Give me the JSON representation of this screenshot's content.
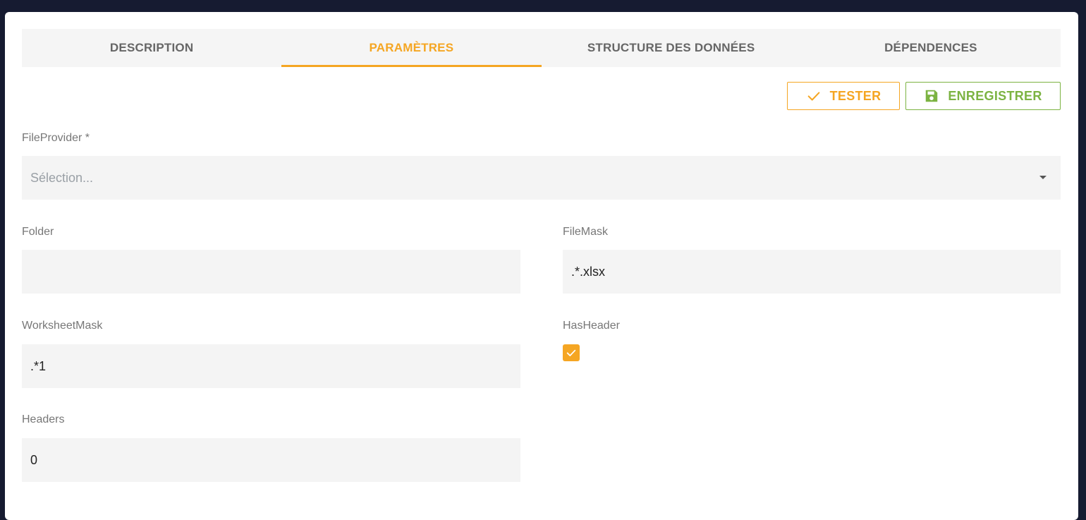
{
  "tabs": [
    {
      "label": "DESCRIPTION",
      "active": false
    },
    {
      "label": "PARAMÈTRES",
      "active": true
    },
    {
      "label": "STRUCTURE DES DONNÉES",
      "active": false
    },
    {
      "label": "DÉPENDENCES",
      "active": false
    }
  ],
  "toolbar": {
    "test_label": "TESTER",
    "test_icon": "check-icon",
    "save_label": "ENREGISTRER",
    "save_icon": "floppy-disk-icon"
  },
  "form": {
    "file_provider": {
      "label": "FileProvider *",
      "placeholder": "Sélection...",
      "value": ""
    },
    "folder": {
      "label": "Folder",
      "value": ""
    },
    "file_mask": {
      "label": "FileMask",
      "value": ".*.xlsx"
    },
    "worksheet_mask": {
      "label": "WorksheetMask",
      "value": ".*1"
    },
    "has_header": {
      "label": "HasHeader",
      "checked": true
    },
    "headers": {
      "label": "Headers",
      "value": "0"
    }
  },
  "colors": {
    "accent": "#f5a623",
    "save": "#7cb342",
    "background": "#161b31"
  }
}
